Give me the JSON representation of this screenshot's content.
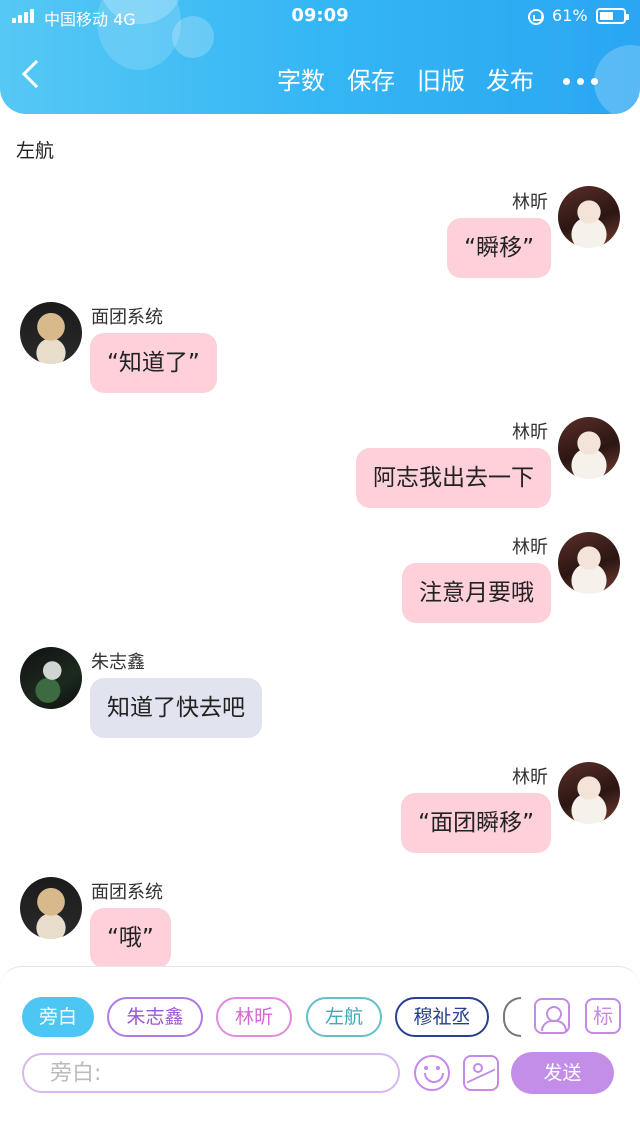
{
  "status_bar": {
    "carrier": "中国移动",
    "network": "4G",
    "time": "09:09",
    "battery": "61%",
    "battery_level": 0.61
  },
  "toolbar": {
    "word_count": "字数",
    "save": "保存",
    "old_version": "旧版",
    "publish": "发布"
  },
  "chat": {
    "m1": {
      "text": "左航"
    },
    "m2": {
      "name": "林昕",
      "text": "“瞬移”"
    },
    "m3": {
      "name": "面团系统",
      "text": "“知道了”"
    },
    "m4": {
      "name": "林昕",
      "text": "阿志我出去一下"
    },
    "m5": {
      "name": "林昕",
      "text": "注意月要哦"
    },
    "m6": {
      "name": "朱志鑫",
      "text": "知道了快去吧"
    },
    "m7": {
      "name": "林昕",
      "text": "“面团瞬移”"
    },
    "m8": {
      "name": "面团系统",
      "text": "“哦”"
    }
  },
  "roles": {
    "r1": "旁白",
    "r2": "朱志鑫",
    "r3": "林昕",
    "r4": "左航",
    "r5": "穆祉丞",
    "label_icon": "标"
  },
  "input": {
    "placeholder": "旁白:",
    "value": ""
  },
  "send": "发送",
  "colors": {
    "header": "#35b6f4",
    "bubble_pink": "#fdd0da",
    "bubble_blue": "#e1e4ef",
    "send": "#c28ee8",
    "active_chip": "#4cc6f2"
  },
  "icons": [
    "back-arrow-icon",
    "more-icon",
    "person-icon",
    "emoji-icon",
    "image-icon"
  ]
}
